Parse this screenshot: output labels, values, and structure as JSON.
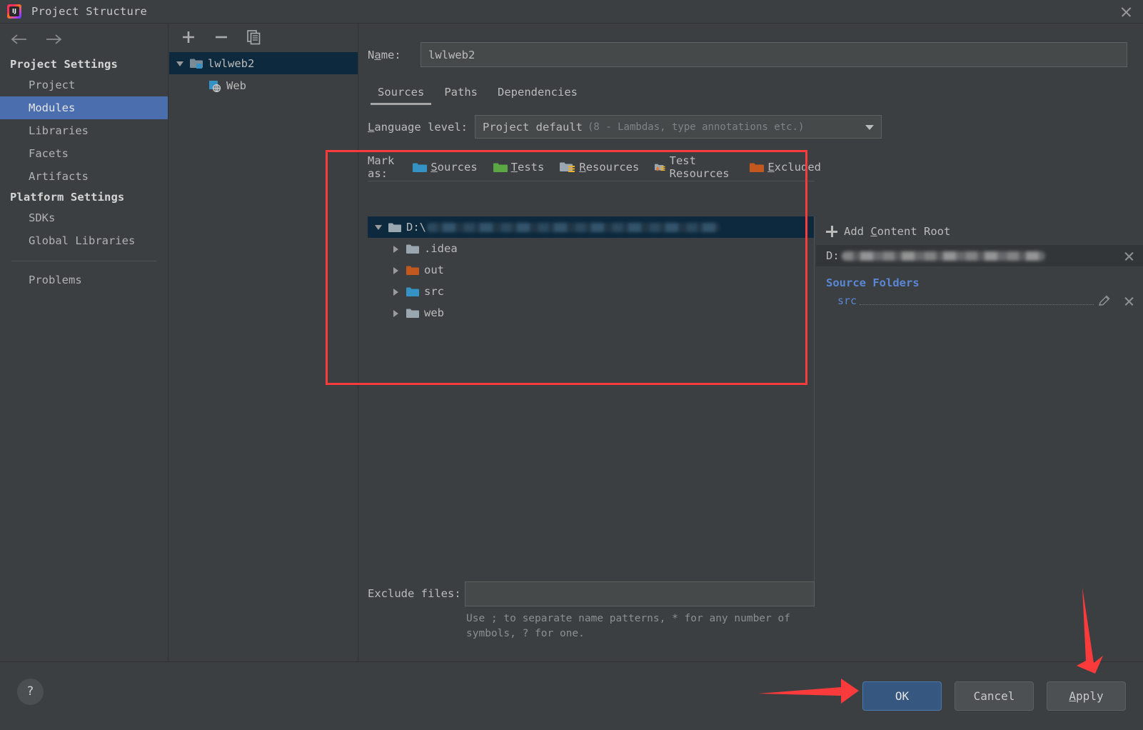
{
  "window": {
    "title": "Project Structure",
    "app_icon": "intellij-idea-icon",
    "close_icon": "close-icon"
  },
  "sidebar": {
    "back_icon": "arrow-left-icon",
    "forward_icon": "arrow-right-icon",
    "groups": [
      {
        "label": "Project Settings",
        "items": [
          {
            "label": "Project",
            "selected": false
          },
          {
            "label": "Modules",
            "selected": true
          },
          {
            "label": "Libraries",
            "selected": false
          },
          {
            "label": "Facets",
            "selected": false
          },
          {
            "label": "Artifacts",
            "selected": false
          }
        ]
      },
      {
        "label": "Platform Settings",
        "items": [
          {
            "label": "SDKs",
            "selected": false
          },
          {
            "label": "Global Libraries",
            "selected": false
          }
        ]
      }
    ],
    "problems_label": "Problems"
  },
  "module_panel": {
    "toolbar": {
      "add_label": "+",
      "remove_label": "−",
      "copy_label": "copy"
    },
    "tree": [
      {
        "label": "lwlweb2",
        "selected": true,
        "expanded": true,
        "icon": "module-folder-icon",
        "depth": 0
      },
      {
        "label": "Web",
        "selected": false,
        "expanded": false,
        "icon": "web-facet-icon",
        "depth": 1
      }
    ]
  },
  "main": {
    "name_label": "Name:",
    "name_label_u1": "N",
    "name_label_u2": "a",
    "name_label_u3": "me:",
    "name_value": "lwlweb2",
    "tabs": [
      {
        "label": "Sources",
        "active": true
      },
      {
        "label": "Paths",
        "active": false
      },
      {
        "label": "Dependencies",
        "active": false
      }
    ],
    "language_level": {
      "label_u": "L",
      "label_rest": "anguage level:",
      "value": "Project default",
      "value_hint": "(8 - Lambdas, type annotations etc.)",
      "caret_icon": "chevron-down-icon"
    },
    "mark_as": {
      "label": "Mark as:",
      "options": [
        {
          "label": "Sources",
          "mnemonic": "S",
          "rest": "ources",
          "color": "#3592c4",
          "icon": "folder-sources-icon"
        },
        {
          "label": "Tests",
          "mnemonic": "T",
          "rest": "ests",
          "color": "#62b543",
          "icon": "folder-tests-icon"
        },
        {
          "label": "Resources",
          "mnemonic": "R",
          "rest": "esources",
          "color": "#9aa7b0",
          "icon": "folder-resources-icon"
        },
        {
          "label": "Test Resources",
          "mnemonic": "",
          "rest": "Test Resources",
          "color": "#9aa7b0",
          "icon": "folder-test-resources-icon"
        },
        {
          "label": "Excluded",
          "mnemonic": "E",
          "rest": "xcluded",
          "color": "#c75450",
          "icon": "folder-excluded-icon"
        }
      ]
    },
    "folder_tree": [
      {
        "label": "D:\\",
        "blurred_path": true,
        "selected": true,
        "expanded": true,
        "depth": 0,
        "color": "#9aa7b0",
        "icon": "folder-icon"
      },
      {
        "label": ".idea",
        "blurred_path": false,
        "selected": false,
        "expanded": false,
        "depth": 1,
        "color": "#9aa7b0",
        "icon": "folder-icon"
      },
      {
        "label": "out",
        "blurred_path": false,
        "selected": false,
        "expanded": false,
        "depth": 1,
        "color": "#c2581e",
        "icon": "folder-excluded-icon"
      },
      {
        "label": "src",
        "blurred_path": false,
        "selected": false,
        "expanded": false,
        "depth": 1,
        "color": "#3592c4",
        "icon": "folder-sources-icon"
      },
      {
        "label": "web",
        "blurred_path": false,
        "selected": false,
        "expanded": false,
        "depth": 1,
        "color": "#9aa7b0",
        "icon": "folder-icon"
      }
    ],
    "exclude_files": {
      "label": "Exclude files:",
      "value": "",
      "hint": "Use ; to separate name patterns, * for any number of symbols, ? for one."
    }
  },
  "detail_pane": {
    "add_content_root": {
      "label_pre": "Add ",
      "label_mn": "C",
      "label_post": "ontent Root",
      "plus_icon": "plus-icon"
    },
    "content_root": {
      "drive": "D:",
      "blurred": true,
      "remove_icon": "close-icon"
    },
    "source_folders_label": "Source Folders",
    "source_folders": [
      {
        "name": "src",
        "edit_icon": "pencil-icon",
        "remove_icon": "close-icon"
      }
    ]
  },
  "footer": {
    "help_label": "?",
    "buttons": [
      {
        "label": "OK",
        "primary": true,
        "mnemonic": ""
      },
      {
        "label": "Cancel",
        "primary": false,
        "mnemonic": ""
      },
      {
        "label": "Apply",
        "primary": false,
        "mnemonic": "A"
      }
    ]
  },
  "annotations": {
    "highlight_color": "#fb3b3b",
    "rect_target": "sources-mark-as-and-tree",
    "arrow_ok_target": "ok-button",
    "arrow_apply_target": "apply-button"
  }
}
